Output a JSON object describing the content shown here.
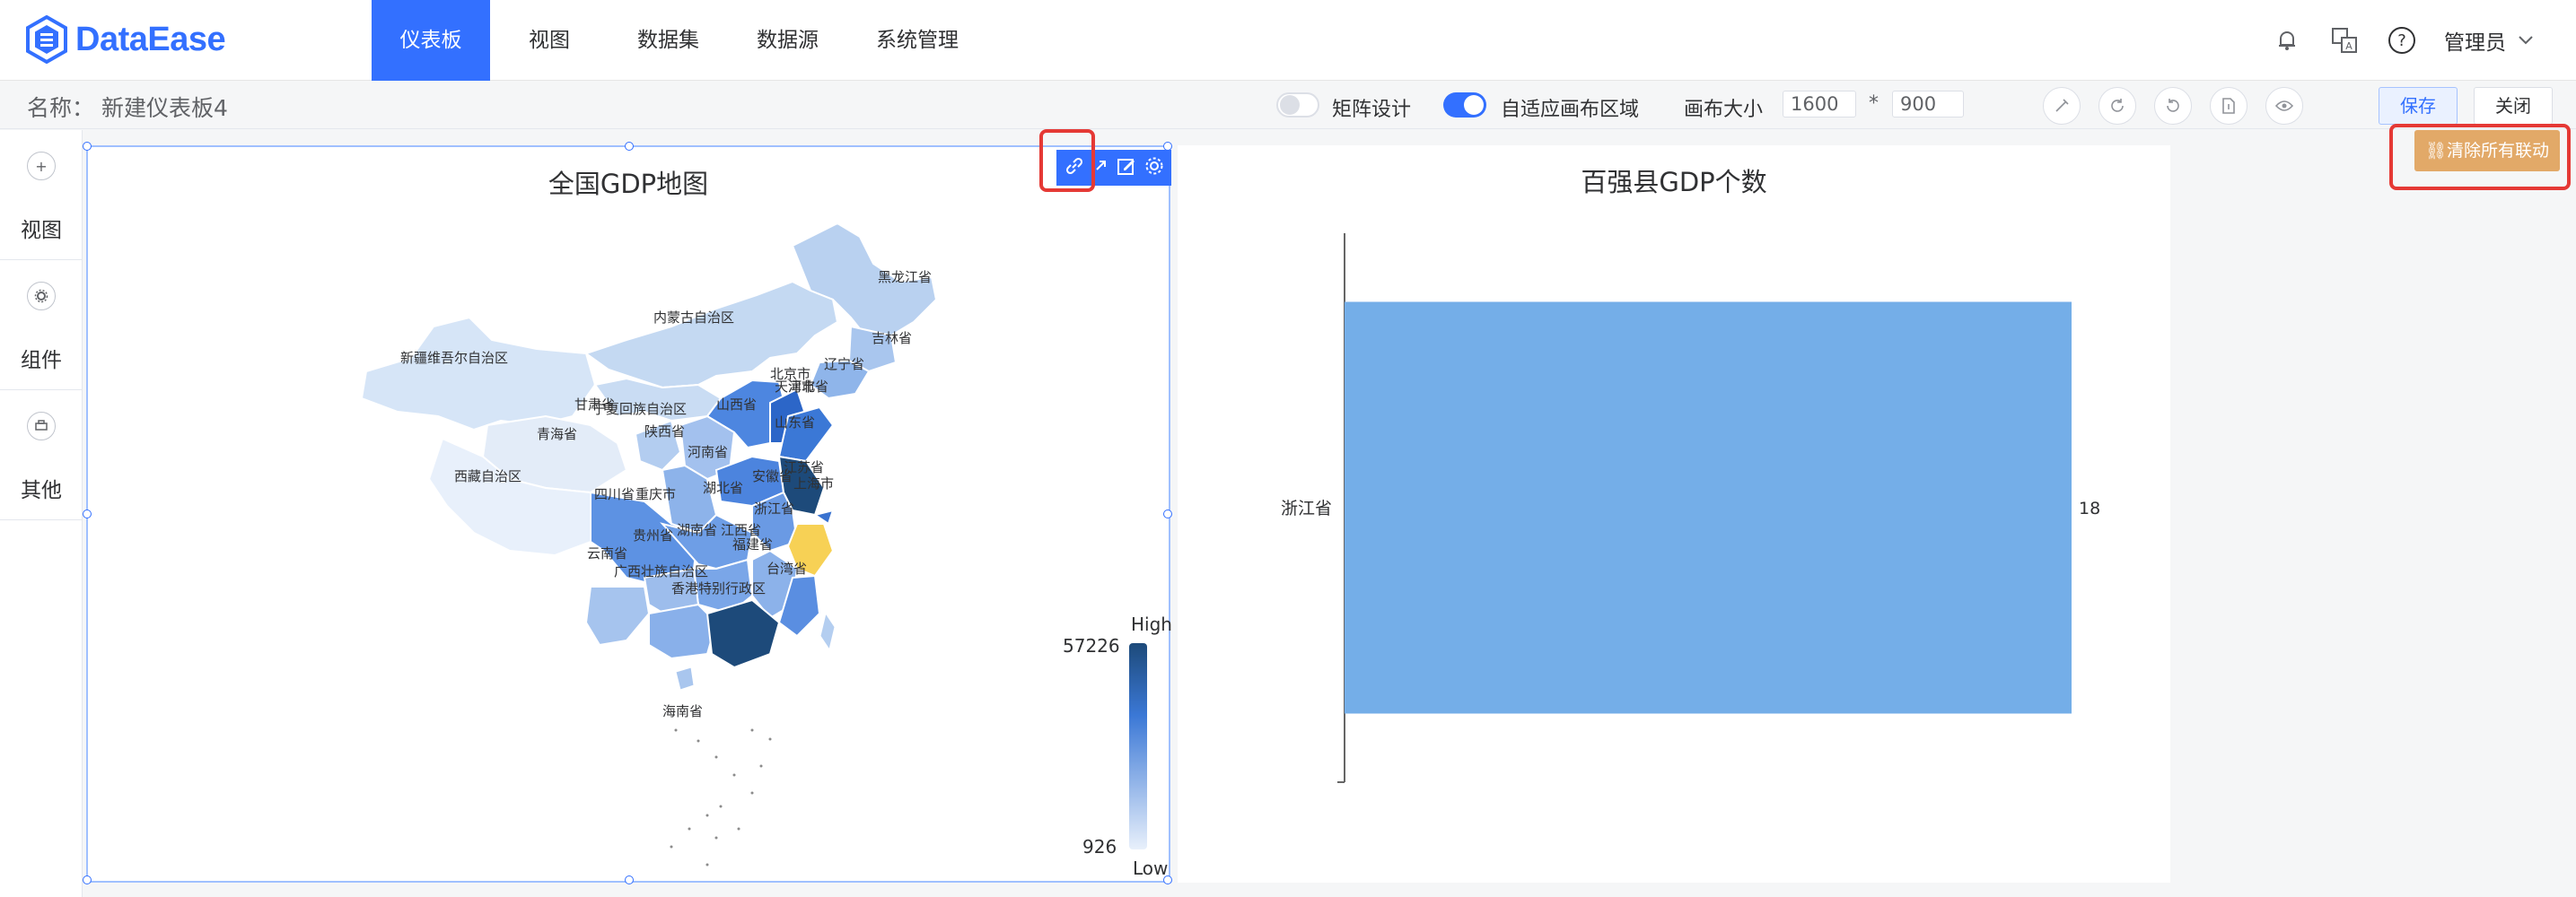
{
  "header": {
    "logo_text": "DataEase",
    "nav": [
      "仪表板",
      "视图",
      "数据集",
      "数据源",
      "系统管理"
    ],
    "user": "管理员"
  },
  "subheader": {
    "name_label": "名称：",
    "name_value": "新建仪表板4",
    "matrix_label": "矩阵设计",
    "autofit_label": "自适应画布区域",
    "canvas_size_label": "画布大小",
    "canvas_width": "1600",
    "canvas_height": "900",
    "times": "*",
    "save": "保存",
    "close": "关闭"
  },
  "sidebar": {
    "items": [
      {
        "label": "视图",
        "icon": "plus-circle-icon"
      },
      {
        "label": "组件",
        "icon": "gear-icon"
      },
      {
        "label": "其他",
        "icon": "print-icon"
      }
    ]
  },
  "actions": {
    "clear_linkage": "清除所有联动"
  },
  "map_panel": {
    "title": "全国GDP地图",
    "legend_high": "High",
    "legend_low": "Low",
    "legend_max": "57226",
    "legend_min": "926",
    "colors": {
      "low": "#e8f0fb",
      "high": "#1d4a7a",
      "selected": "#f7d155"
    },
    "regions": [
      "黑龙江省",
      "内蒙古自治区",
      "吉林省",
      "辽宁省",
      "新疆维吾尔自治区",
      "北京市",
      "天津市",
      "河北省",
      "甘肃省",
      "宁夏回族自治区",
      "山西省",
      "青海省",
      "陕西省",
      "山东省",
      "河南省",
      "江苏省",
      "西藏自治区",
      "四川省",
      "重庆市",
      "湖北省",
      "安徽省",
      "上海市",
      "浙江省",
      "贵州省",
      "湖南省",
      "江西省",
      "云南省",
      "福建省",
      "广西壮族自治区",
      "台湾省",
      "香港特别行政区",
      "海南省"
    ]
  },
  "chart_data": {
    "type": "bar",
    "title": "百强县GDP个数",
    "orientation": "horizontal",
    "categories": [
      "浙江省"
    ],
    "values": [
      18
    ],
    "series": [
      {
        "values": [
          18
        ],
        "color": "#74aee8"
      }
    ]
  }
}
